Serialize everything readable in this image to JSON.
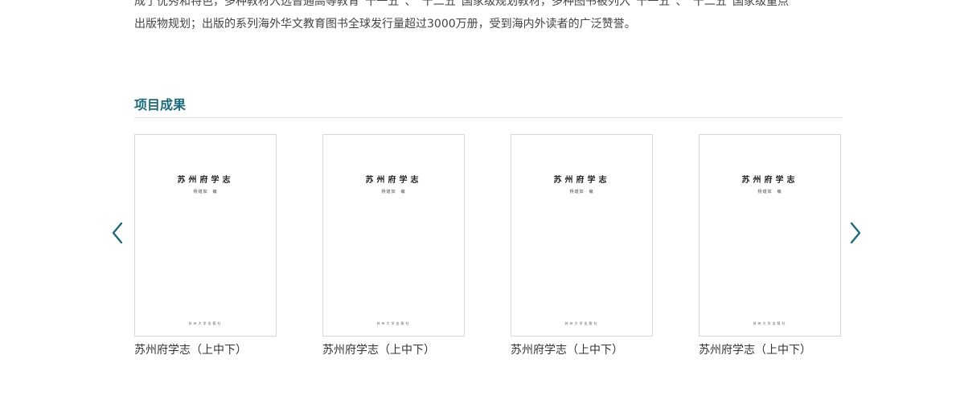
{
  "intro": {
    "line1": "成了优秀和特色，多种教材入选普通高等教育“十一五”、“十二五”国家级规划教材，多种图书被列入“十一五”、“十二五”国家级重点",
    "line2": "出版物规划；出版的系列海外华文教育图书全球发行量超过3000万册，受到海内外读者的广泛赞誉。"
  },
  "section": {
    "title": "项目成果"
  },
  "books": [
    {
      "name": "苏州府学志（上中下）",
      "cover_title": "苏州府学志",
      "cover_author": "杨燧如　编",
      "cover_publisher": "苏州大学出版社"
    },
    {
      "name": "苏州府学志（上中下）",
      "cover_title": "苏州府学志",
      "cover_author": "杨燧如　编",
      "cover_publisher": "苏州大学出版社"
    },
    {
      "name": "苏州府学志（上中下）",
      "cover_title": "苏州府学志",
      "cover_author": "杨燧如　编",
      "cover_publisher": "苏州大学出版社"
    },
    {
      "name": "苏州府学志（上中下）",
      "cover_title": "苏州府学志",
      "cover_author": "杨燧如　编",
      "cover_publisher": "苏州大学出版社"
    }
  ],
  "icons": {
    "prev": "chevron-left-icon",
    "next": "chevron-right-icon"
  },
  "colors": {
    "accent": "#1a6b7c",
    "text": "#333333",
    "border": "#d9d9d9"
  }
}
